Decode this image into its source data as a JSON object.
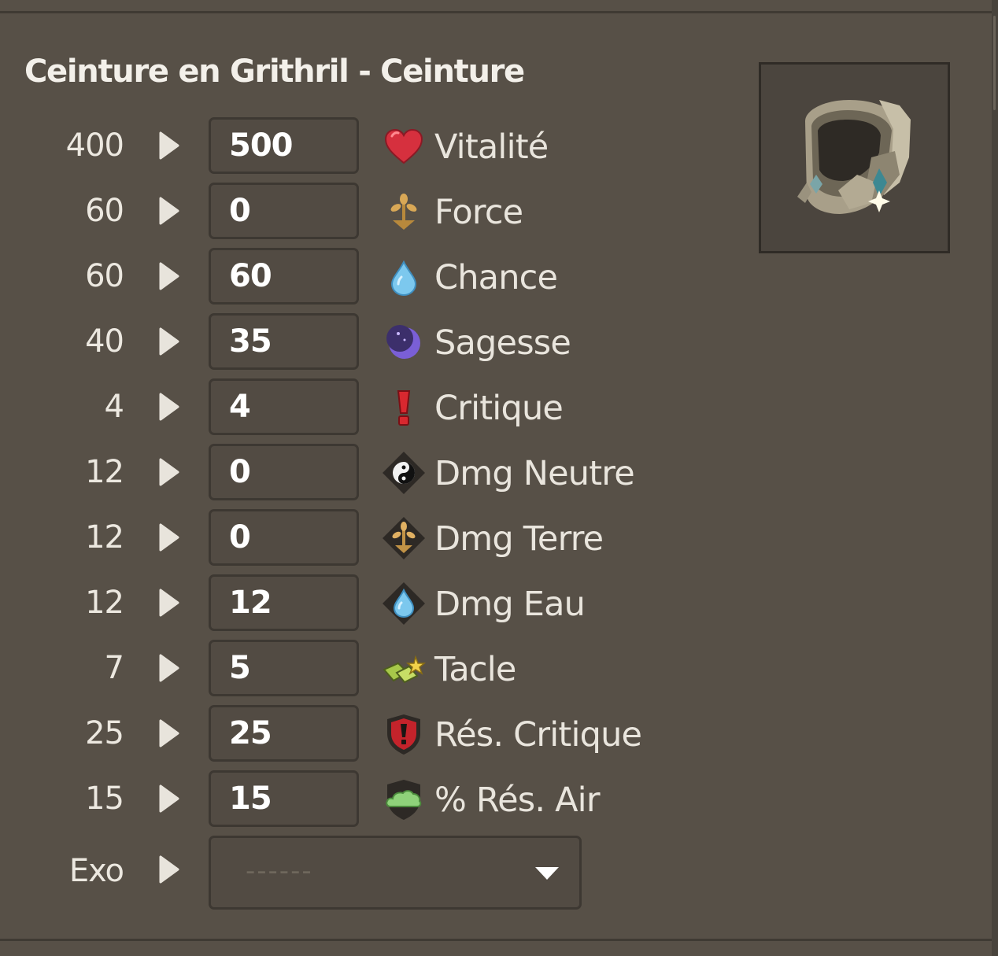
{
  "item": {
    "title": "Ceinture en Grithril - Ceinture",
    "image": "belt-item-icon"
  },
  "stats": [
    {
      "base": "400",
      "value": "500",
      "label": "Vitalité",
      "icon": "heart-icon"
    },
    {
      "base": "60",
      "value": "0",
      "label": "Force",
      "icon": "earth-sprout-icon"
    },
    {
      "base": "60",
      "value": "60",
      "label": "Chance",
      "icon": "water-drop-icon"
    },
    {
      "base": "40",
      "value": "35",
      "label": "Sagesse",
      "icon": "moon-icon"
    },
    {
      "base": "4",
      "value": "4",
      "label": "Critique",
      "icon": "exclamation-icon"
    },
    {
      "base": "12",
      "value": "0",
      "label": "Dmg Neutre",
      "icon": "yin-yang-icon"
    },
    {
      "base": "12",
      "value": "0",
      "label": "Dmg Terre",
      "icon": "earth-damage-icon"
    },
    {
      "base": "12",
      "value": "12",
      "label": "Dmg Eau",
      "icon": "water-damage-icon"
    },
    {
      "base": "7",
      "value": "5",
      "label": "Tacle",
      "icon": "lock-tackle-icon"
    },
    {
      "base": "25",
      "value": "25",
      "label": "Rés. Critique",
      "icon": "shield-exclamation-icon"
    },
    {
      "base": "15",
      "value": "15",
      "label": "% Rés. Air",
      "icon": "air-cloud-icon"
    }
  ],
  "exo": {
    "label": "Exo",
    "placeholder": "------"
  },
  "colors": {
    "background": "#575047",
    "field": "#524b43",
    "field_border": "#3d3832",
    "text": "#ece8e0"
  }
}
